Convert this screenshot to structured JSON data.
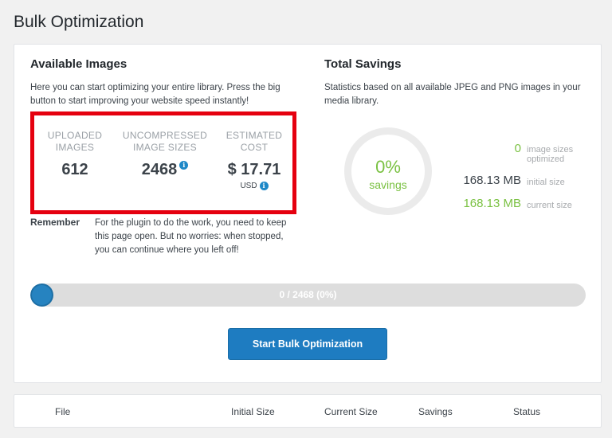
{
  "page_title": "Bulk Optimization",
  "available_images": {
    "title": "Available Images",
    "description": "Here you can start optimizing your entire library. Press the big button to start improving your website speed instantly!",
    "stats": {
      "uploaded": {
        "label_line1": "UPLOADED",
        "label_line2": "IMAGES",
        "value": "612"
      },
      "uncompressed": {
        "label_line1": "UNCOMPRESSED",
        "label_line2": "IMAGE SIZES",
        "value": "2468"
      },
      "estimated": {
        "label_line1": "ESTIMATED",
        "label_line2": "COST",
        "value": "$ 17.71",
        "currency": "USD"
      }
    },
    "info_glyph": "i",
    "remember_label": "Remember",
    "remember_text": "For the plugin to do the work, you need to keep this page open. But no worries: when stopped, you can continue where you left off!"
  },
  "total_savings": {
    "title": "Total Savings",
    "description": "Statistics based on all available JPEG and PNG images in your media library.",
    "percent": "0%",
    "percent_label": "savings",
    "optimized_count": "0",
    "optimized_label_line1": "image sizes",
    "optimized_label_line2": "optimized",
    "initial_size": "168.13 MB",
    "initial_label": "initial size",
    "current_size": "168.13 MB",
    "current_label": "current size"
  },
  "progress": {
    "text": "0 / 2468 (0%)",
    "fraction": 0.0
  },
  "start_button_label": "Start Bulk Optimization",
  "table": {
    "columns": [
      "File",
      "Initial Size",
      "Current Size",
      "Savings",
      "Status"
    ]
  },
  "colors": {
    "accent_blue": "#1e7cc1",
    "savings_green": "#7ac142",
    "highlight_red": "#e5000f"
  }
}
